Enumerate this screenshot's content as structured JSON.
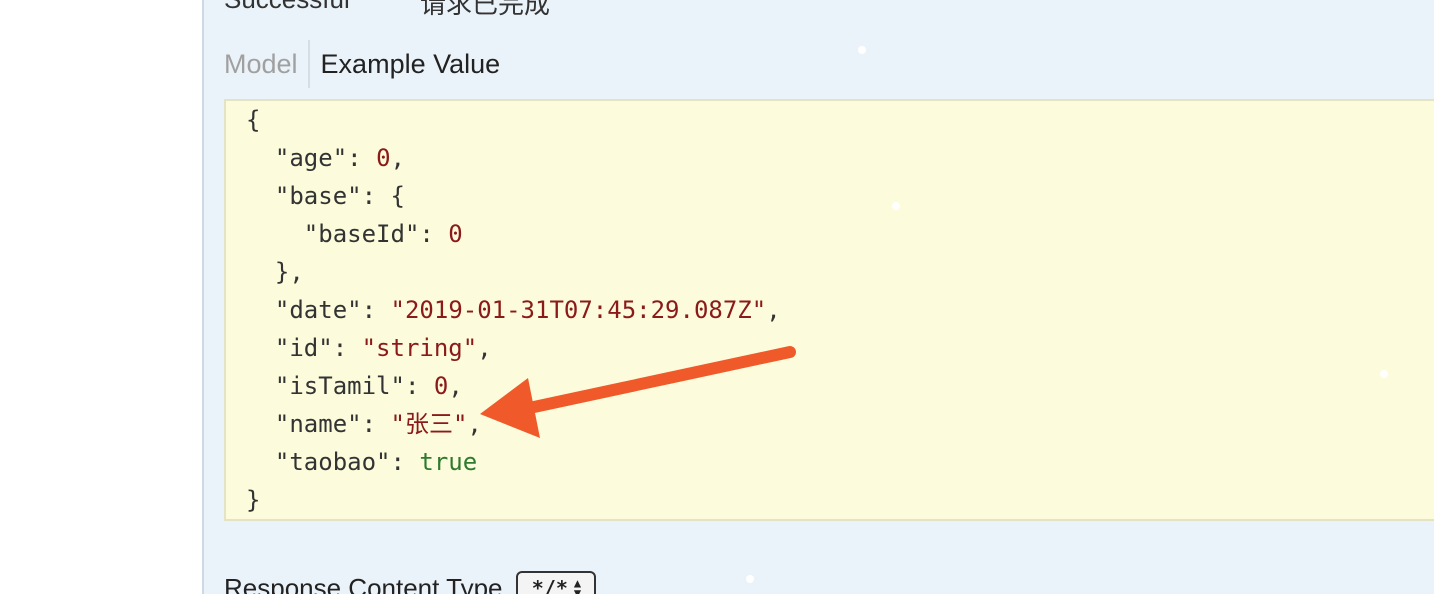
{
  "response": {
    "status_text": "Successful",
    "status_desc": "请求已完成"
  },
  "tabs": {
    "model": "Model",
    "example": "Example Value"
  },
  "example_json": {
    "open_brace": "{",
    "close_brace": "}",
    "age_key": "\"age\"",
    "age_value": "0",
    "base_key": "\"base\"",
    "baseId_key": "\"baseId\"",
    "baseId_value": "0",
    "date_key": "\"date\"",
    "date_value": "\"2019-01-31T07:45:29.087Z\"",
    "id_key": "\"id\"",
    "id_value": "\"string\"",
    "isTamil_key": "\"isTamil\"",
    "isTamil_value": "0",
    "name_key": "\"name\"",
    "name_value": "\"张三\"",
    "taobao_key": "\"taobao\"",
    "taobao_value": "true"
  },
  "response_content_type": {
    "label": "Response Content Type",
    "selected": "*/*"
  },
  "colors": {
    "panel_bg": "#ebf3fa",
    "code_bg": "#fcfcdc",
    "string_value": "#8b1a1a",
    "bool_value": "#2f7a2f",
    "arrow": "#f05a2a"
  },
  "icons": {
    "annotation": "arrow-annotation-icon",
    "select_arrows": "updown-arrows-icon"
  }
}
